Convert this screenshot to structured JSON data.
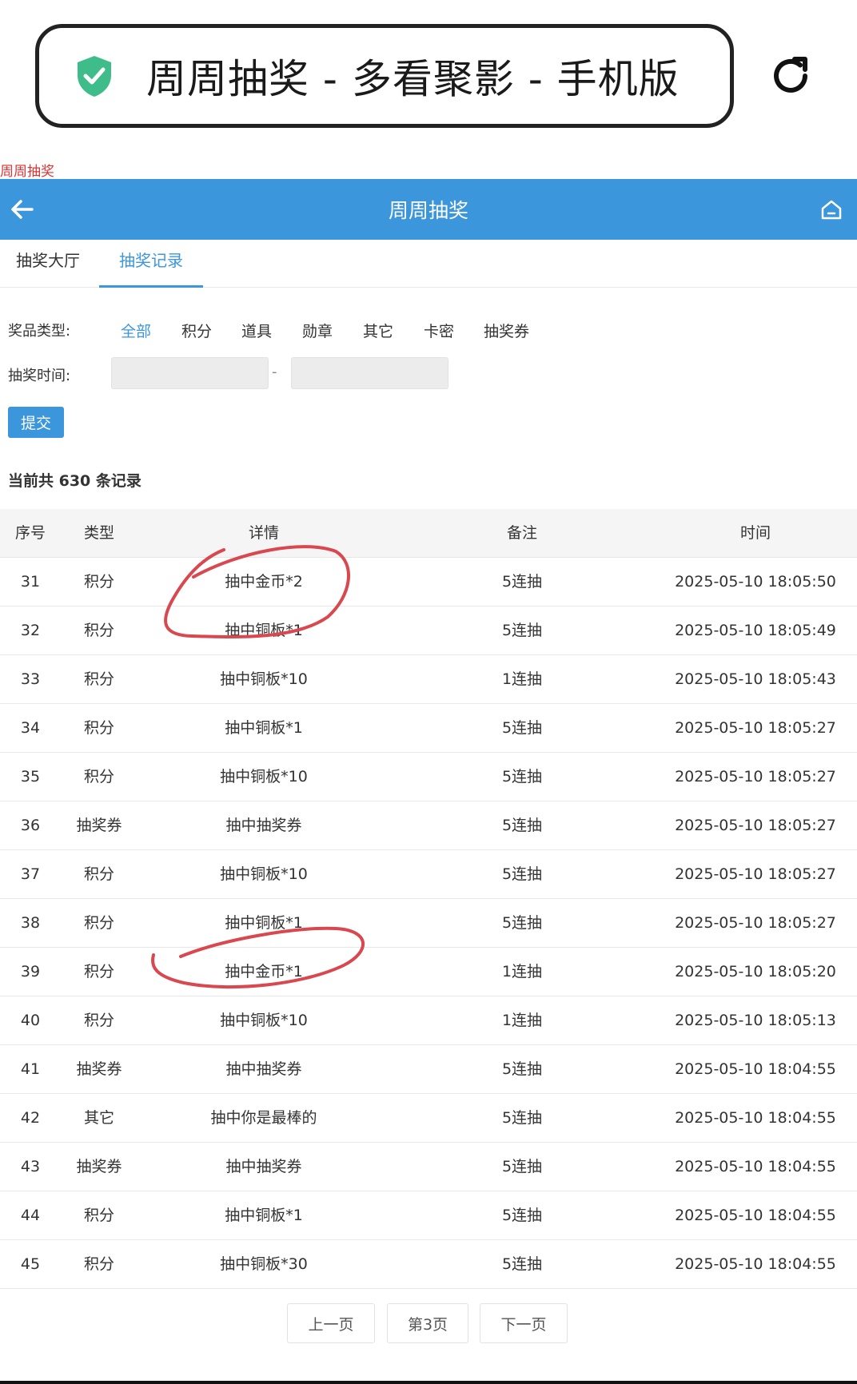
{
  "browser": {
    "url_title": "周周抽奖 - 多看聚影 - 手机版",
    "secure_icon": "shield-check-icon",
    "reload_icon": "reload-icon"
  },
  "doc_title": "周周抽奖",
  "header": {
    "title": "周周抽奖",
    "back_icon": "arrow-left-icon",
    "home_icon": "home-icon",
    "color": "#3b96dc"
  },
  "tabs": [
    {
      "label": "抽奖大厅",
      "active": false
    },
    {
      "label": "抽奖记录",
      "active": true
    }
  ],
  "filters": {
    "type_label": "奖品类型:",
    "types": [
      "全部",
      "积分",
      "道具",
      "勋章",
      "其它",
      "卡密",
      "抽奖券"
    ],
    "selected_type": "全部",
    "time_label": "抽奖时间:",
    "start_date": "",
    "end_date": "",
    "separator": "-",
    "submit_label": "提交"
  },
  "summary": "当前共 630 条记录",
  "table": {
    "headers": [
      "序号",
      "类型",
      "详情",
      "备注",
      "时间"
    ],
    "rows": [
      [
        "31",
        "积分",
        "抽中金币*2",
        "5连抽",
        "2025-05-10 18:05:50"
      ],
      [
        "32",
        "积分",
        "抽中铜板*1",
        "5连抽",
        "2025-05-10 18:05:49"
      ],
      [
        "33",
        "积分",
        "抽中铜板*10",
        "1连抽",
        "2025-05-10 18:05:43"
      ],
      [
        "34",
        "积分",
        "抽中铜板*1",
        "5连抽",
        "2025-05-10 18:05:27"
      ],
      [
        "35",
        "积分",
        "抽中铜板*10",
        "5连抽",
        "2025-05-10 18:05:27"
      ],
      [
        "36",
        "抽奖券",
        "抽中抽奖券",
        "5连抽",
        "2025-05-10 18:05:27"
      ],
      [
        "37",
        "积分",
        "抽中铜板*10",
        "5连抽",
        "2025-05-10 18:05:27"
      ],
      [
        "38",
        "积分",
        "抽中铜板*1",
        "5连抽",
        "2025-05-10 18:05:27"
      ],
      [
        "39",
        "积分",
        "抽中金币*1",
        "1连抽",
        "2025-05-10 18:05:20"
      ],
      [
        "40",
        "积分",
        "抽中铜板*10",
        "1连抽",
        "2025-05-10 18:05:13"
      ],
      [
        "41",
        "抽奖券",
        "抽中抽奖券",
        "5连抽",
        "2025-05-10 18:04:55"
      ],
      [
        "42",
        "其它",
        "抽中你是最棒的",
        "5连抽",
        "2025-05-10 18:04:55"
      ],
      [
        "43",
        "抽奖券",
        "抽中抽奖券",
        "5连抽",
        "2025-05-10 18:04:55"
      ],
      [
        "44",
        "积分",
        "抽中铜板*1",
        "5连抽",
        "2025-05-10 18:04:55"
      ],
      [
        "45",
        "积分",
        "抽中铜板*30",
        "5连抽",
        "2025-05-10 18:04:55"
      ]
    ]
  },
  "pagination": {
    "prev_label": "上一页",
    "current_label": "第3页",
    "next_label": "下一页"
  },
  "annotation_color": "#d9474f"
}
